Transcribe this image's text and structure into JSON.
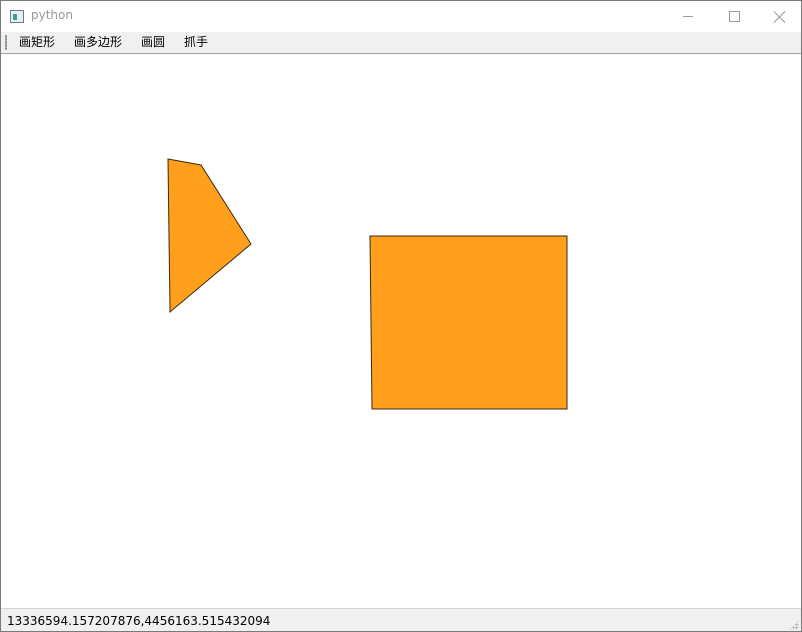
{
  "window": {
    "title": "python",
    "app_icon": "app-window-icon",
    "controls": {
      "minimize_icon": "minimize-icon",
      "maximize_icon": "maximize-icon",
      "close_icon": "close-icon"
    }
  },
  "toolbar": {
    "draw_rect_label": "画矩形",
    "draw_polygon_label": "画多边形",
    "draw_circle_label": "画圆",
    "grab_label": "抓手"
  },
  "canvas": {
    "shape_fill": "#ff9f1c",
    "shape_stroke": "#3a2a10",
    "background": "#ffffff"
  },
  "statusbar": {
    "coordinates": "13336594.157207876,4456163.515432094"
  }
}
